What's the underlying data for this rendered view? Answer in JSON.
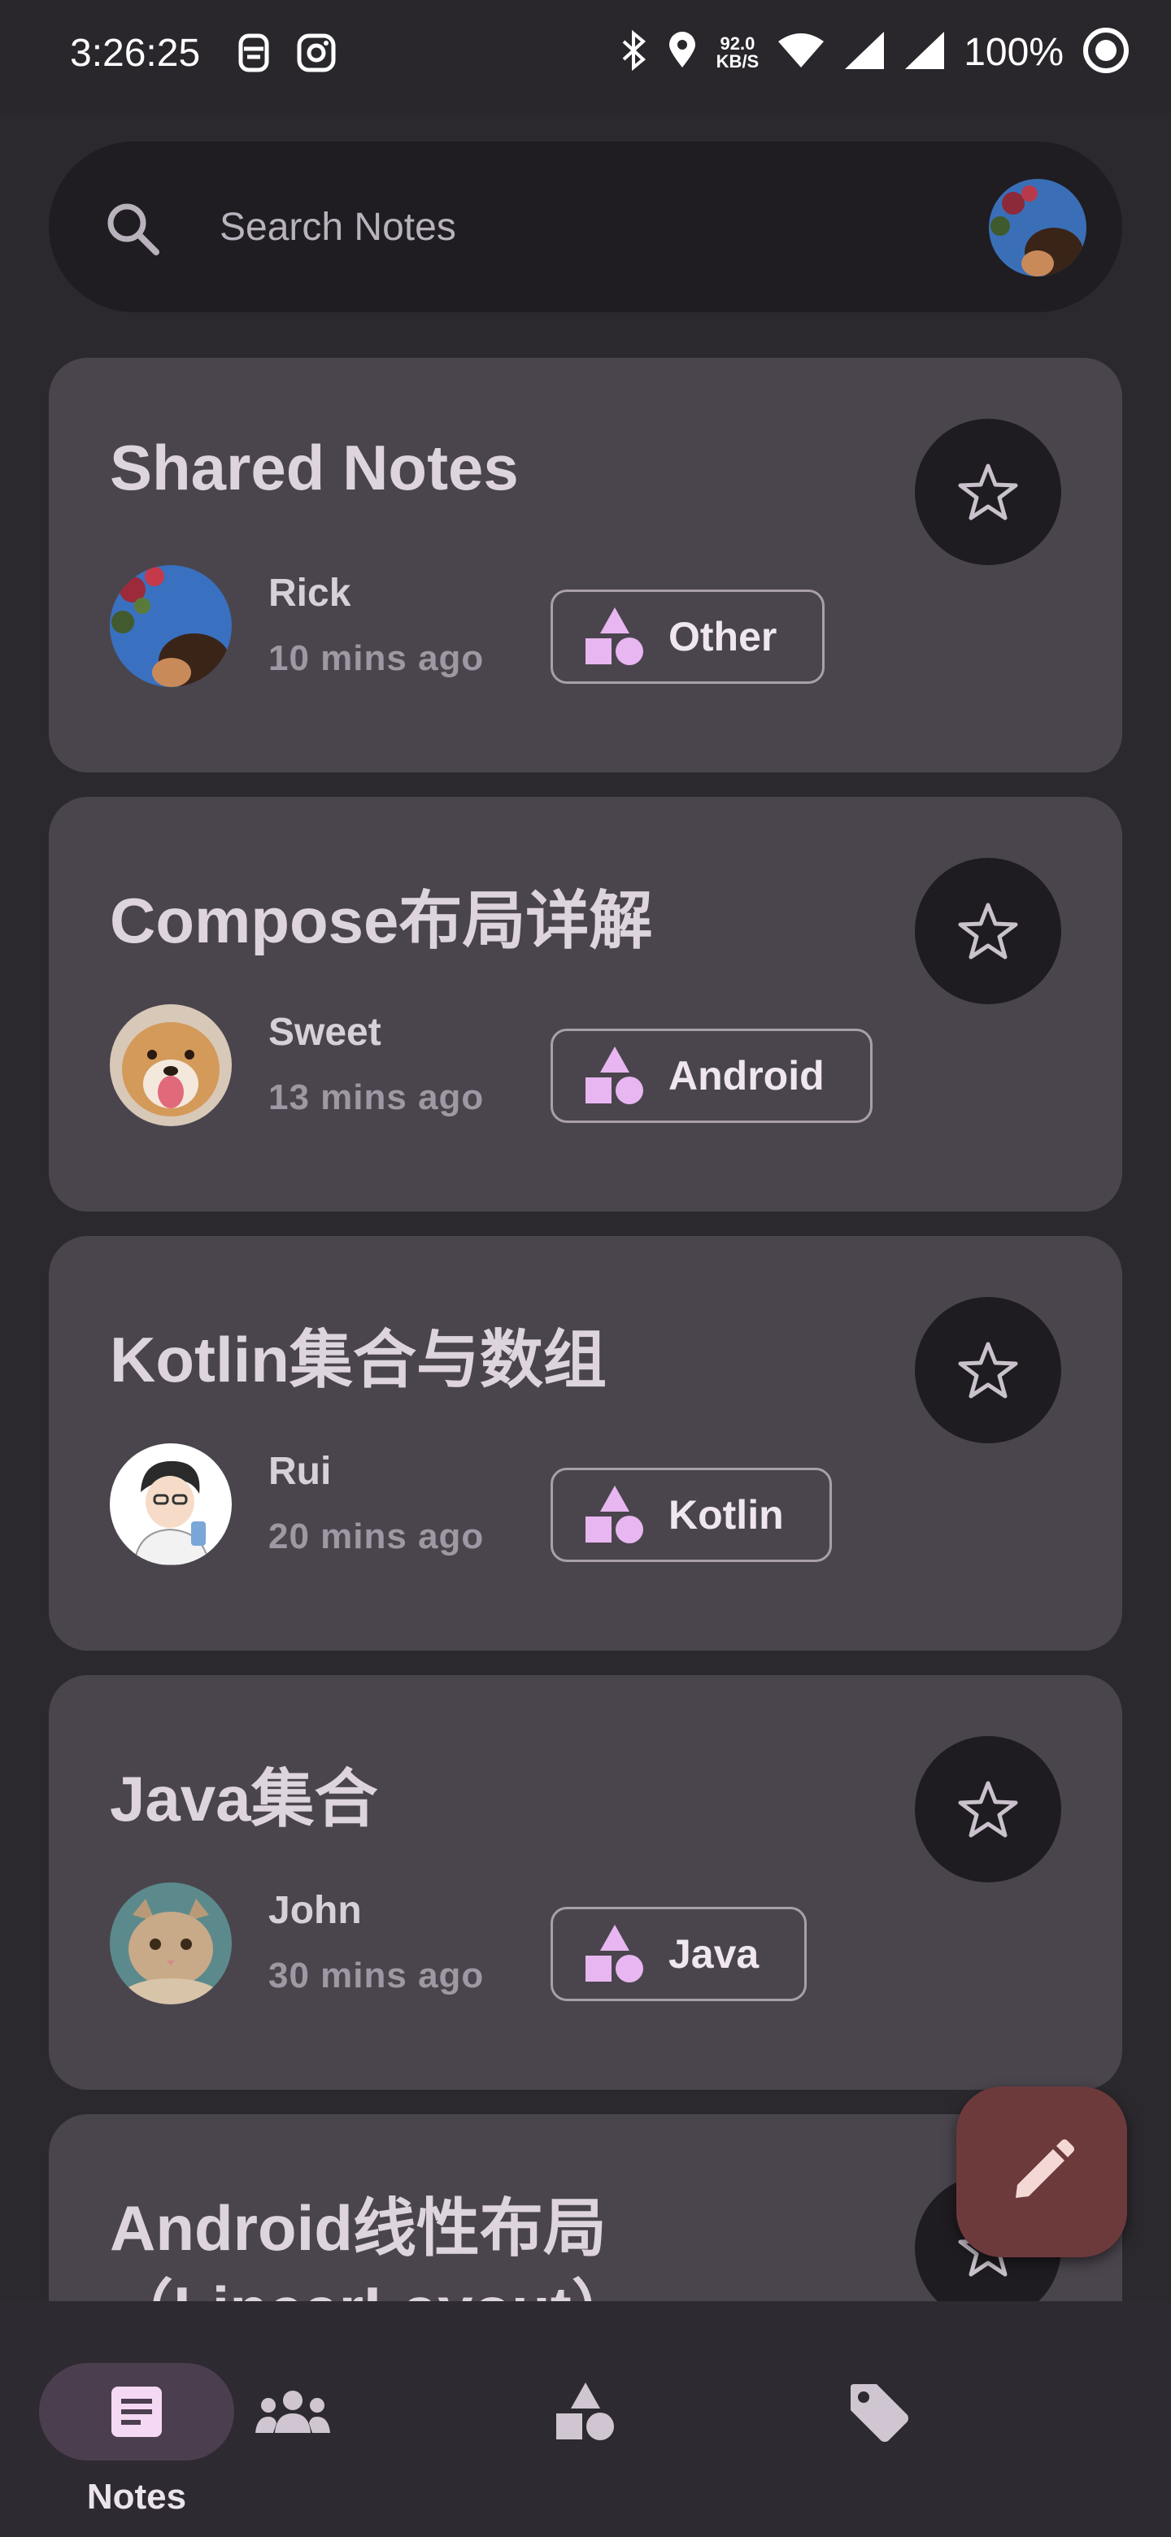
{
  "status_bar": {
    "time": "3:26:25",
    "speed_value": "92.0",
    "speed_unit": "KB/S",
    "battery": "100%"
  },
  "search": {
    "placeholder": "Search Notes"
  },
  "notes": [
    {
      "title": "Shared Notes",
      "author": "Rick",
      "time": "10 mins ago",
      "tag": "Other"
    },
    {
      "title": "Compose布局详解",
      "author": "Sweet",
      "time": "13 mins ago",
      "tag": "Android"
    },
    {
      "title": "Kotlin集合与数组",
      "author": "Rui",
      "time": "20 mins ago",
      "tag": "Kotlin"
    },
    {
      "title": "Java集合",
      "author": "John",
      "time": "30 mins ago",
      "tag": "Java"
    },
    {
      "title": "Android线性布局（LinearLayout）",
      "author": "",
      "time": "",
      "tag": ""
    }
  ],
  "nav": {
    "items": [
      {
        "label": "Notes",
        "icon": "notes-icon",
        "active": true
      },
      {
        "label": "",
        "icon": "people-icon",
        "active": false
      },
      {
        "label": "",
        "icon": "shapes-icon",
        "active": false
      },
      {
        "label": "",
        "icon": "tag-icon",
        "active": false
      }
    ]
  },
  "colors": {
    "background": "#2b292e",
    "card": "#4a454d",
    "accent": "#e8b6f0",
    "fab": "#6d3a3c"
  }
}
